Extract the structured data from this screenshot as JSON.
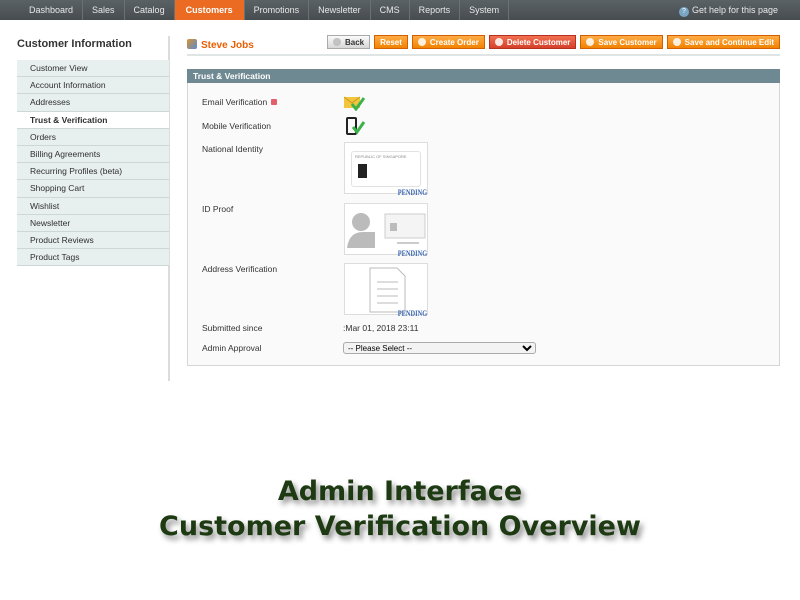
{
  "nav": {
    "items": [
      "Dashboard",
      "Sales",
      "Catalog",
      "Customers",
      "Promotions",
      "Newsletter",
      "CMS",
      "Reports",
      "System"
    ],
    "active": "Customers",
    "help": "Get help for this page"
  },
  "sidebar": {
    "title": "Customer Information",
    "items": [
      "Customer View",
      "Account Information",
      "Addresses",
      "Trust & Verification",
      "Orders",
      "Billing Agreements",
      "Recurring Profiles (beta)",
      "Shopping Cart",
      "Wishlist",
      "Newsletter",
      "Product Reviews",
      "Product Tags"
    ],
    "active": "Trust & Verification"
  },
  "header": {
    "customer_name": "Steve Jobs",
    "buttons": {
      "back": "Back",
      "reset": "Reset",
      "create_order": "Create Order",
      "delete": "Delete Customer",
      "save": "Save Customer",
      "save_continue": "Save and Continue Edit"
    }
  },
  "panel": {
    "title": "Trust & Verification",
    "email_label": "Email Verification",
    "mobile_label": "Mobile Verification",
    "national_label": "National Identity",
    "national_card_text": "REPUBLIC OF SINGAPORE",
    "id_label": "ID Proof",
    "address_label": "Address Verification",
    "pending": "PENDING",
    "submitted_label": "Submitted since",
    "submitted_value": ":Mar 01, 2018 23:11",
    "approval_label": "Admin Approval",
    "approval_value": "-- Please Select --"
  },
  "caption": {
    "line1": "Admin Interface",
    "line2": "Customer Verification Overview"
  }
}
